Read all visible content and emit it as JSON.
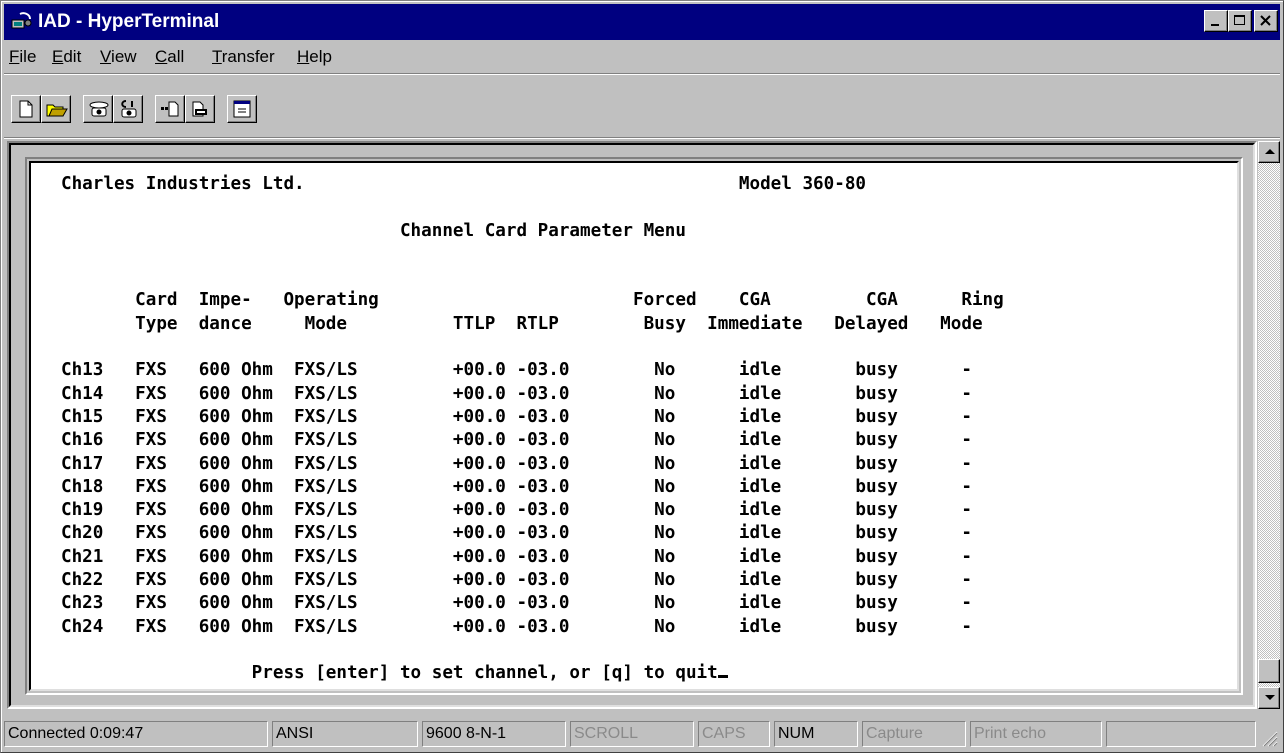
{
  "window": {
    "title": "IAD - HyperTerminal"
  },
  "menu": {
    "items": [
      {
        "hot": "F",
        "rest": "ile"
      },
      {
        "hot": "E",
        "rest": "dit"
      },
      {
        "hot": "V",
        "rest": "iew"
      },
      {
        "hot": "C",
        "rest": "all"
      },
      {
        "hot": "T",
        "rest": "ransfer"
      },
      {
        "hot": "H",
        "rest": "elp"
      }
    ]
  },
  "toolbar": {
    "icons": [
      "new-document-icon",
      "open-folder-icon",
      "connect-phone-icon",
      "disconnect-phone-icon",
      "send-file-icon",
      "receive-file-icon",
      "properties-icon"
    ]
  },
  "terminal": {
    "lines": [
      "Charles Industries Ltd.                                         Model 360-80",
      "",
      "                                Channel Card Parameter Menu",
      "",
      "",
      "       Card  Impe-   Operating                        Forced    CGA         CGA      Ring",
      "       Type  dance     Mode          TTLP  RTLP        Busy  Immediate   Delayed   Mode",
      "",
      "Ch13   FXS   600 Ohm  FXS/LS         +00.0 -03.0        No      idle       busy      -",
      "Ch14   FXS   600 Ohm  FXS/LS         +00.0 -03.0        No      idle       busy      -",
      "Ch15   FXS   600 Ohm  FXS/LS         +00.0 -03.0        No      idle       busy      -",
      "Ch16   FXS   600 Ohm  FXS/LS         +00.0 -03.0        No      idle       busy      -",
      "Ch17   FXS   600 Ohm  FXS/LS         +00.0 -03.0        No      idle       busy      -",
      "Ch18   FXS   600 Ohm  FXS/LS         +00.0 -03.0        No      idle       busy      -",
      "Ch19   FXS   600 Ohm  FXS/LS         +00.0 -03.0        No      idle       busy      -",
      "Ch20   FXS   600 Ohm  FXS/LS         +00.0 -03.0        No      idle       busy      -",
      "Ch21   FXS   600 Ohm  FXS/LS         +00.0 -03.0        No      idle       busy      -",
      "Ch22   FXS   600 Ohm  FXS/LS         +00.0 -03.0        No      idle       busy      -",
      "Ch23   FXS   600 Ohm  FXS/LS         +00.0 -03.0        No      idle       busy      -",
      "Ch24   FXS   600 Ohm  FXS/LS         +00.0 -03.0        No      idle       busy      -",
      "",
      "                  Press [enter] to set channel, or [q] to quit"
    ]
  },
  "status": {
    "connected": "Connected 0:09:47",
    "emulation": "ANSI",
    "settings": "9600 8-N-1",
    "scroll": "SCROLL",
    "caps": "CAPS",
    "num": "NUM",
    "capture": "Capture",
    "print_echo": "Print echo"
  }
}
